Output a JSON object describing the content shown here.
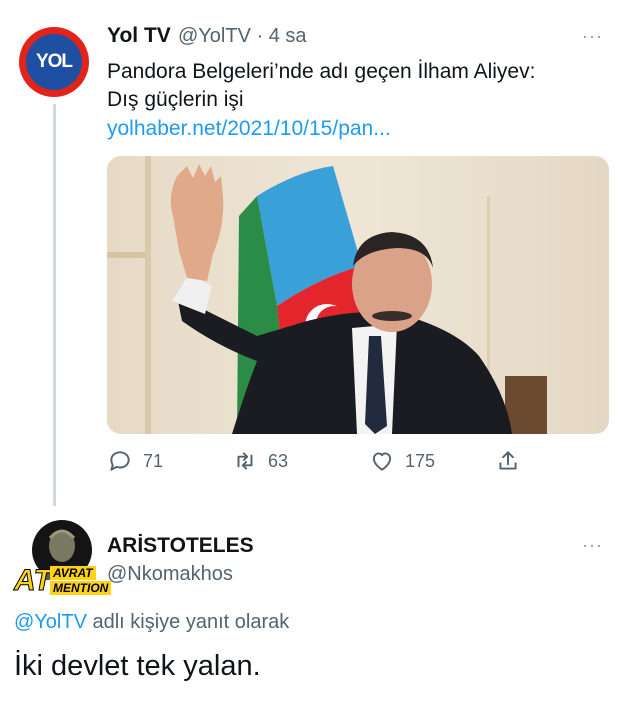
{
  "tweet": {
    "author_name": "Yol TV",
    "author_handle": "@YolTV",
    "time": "4 sa",
    "separator": "·",
    "more": "···",
    "text_line1": "Pandora Belgeleri’nde adı geçen İlham Aliyev:",
    "text_line2": "Dış güçlerin işi",
    "link": "yolhaber.net/2021/10/15/pan...",
    "avatar_logo": "YOL",
    "replies": "71",
    "retweets": "63",
    "likes": "175"
  },
  "reply": {
    "author_name": "ARİSTOTELES",
    "author_handle": "@Nkomakhos",
    "more": "···",
    "reply_to_mention": "@YolTV",
    "reply_to_suffix": " adlı kişiye yanıt olarak",
    "text": "İki devlet tek yalan.",
    "avatar_badge_top": "AVRAT",
    "avatar_badge_left": "AT",
    "avatar_badge_bottom": "MENTION"
  },
  "colors": {
    "accent": "#1d9bf0",
    "secondary_text": "#536471",
    "primary_text": "#0f1419",
    "thread_line": "#cfd9de"
  }
}
